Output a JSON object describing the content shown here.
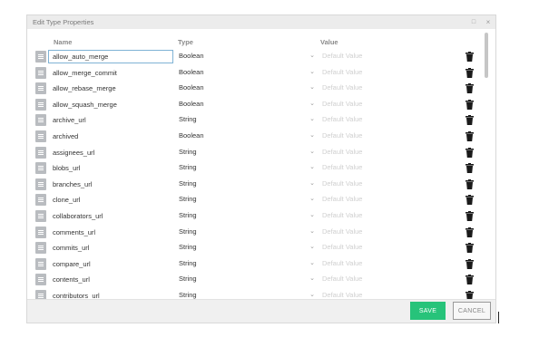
{
  "dialog": {
    "title": "Edit Type Properties",
    "minimize_glyph": "□",
    "close_glyph": "×"
  },
  "columns": {
    "name": "Name",
    "type": "Type",
    "value": "Value"
  },
  "value_placeholder": "Default Value",
  "rows": [
    {
      "name": "allow_auto_merge",
      "type": "Boolean"
    },
    {
      "name": "allow_merge_commit",
      "type": "Boolean"
    },
    {
      "name": "allow_rebase_merge",
      "type": "Boolean"
    },
    {
      "name": "allow_squash_merge",
      "type": "Boolean"
    },
    {
      "name": "archive_url",
      "type": "String"
    },
    {
      "name": "archived",
      "type": "Boolean"
    },
    {
      "name": "assignees_url",
      "type": "String"
    },
    {
      "name": "blobs_url",
      "type": "String"
    },
    {
      "name": "branches_url",
      "type": "String"
    },
    {
      "name": "clone_url",
      "type": "String"
    },
    {
      "name": "collaborators_url",
      "type": "String"
    },
    {
      "name": "comments_url",
      "type": "String"
    },
    {
      "name": "commits_url",
      "type": "String"
    },
    {
      "name": "compare_url",
      "type": "String"
    },
    {
      "name": "contents_url",
      "type": "String"
    },
    {
      "name": "contributors_url",
      "type": "String"
    }
  ],
  "icons": {
    "drag": "drag-handle-icon",
    "dropdown": "chevron-down-icon",
    "delete": "trash-icon"
  },
  "footer": {
    "save_label": "SAVE",
    "cancel_label": "CANCEL"
  },
  "colors": {
    "accent": "#27c37a",
    "handle": "#b9bcc0",
    "focus_border": "#7fb3d5"
  }
}
